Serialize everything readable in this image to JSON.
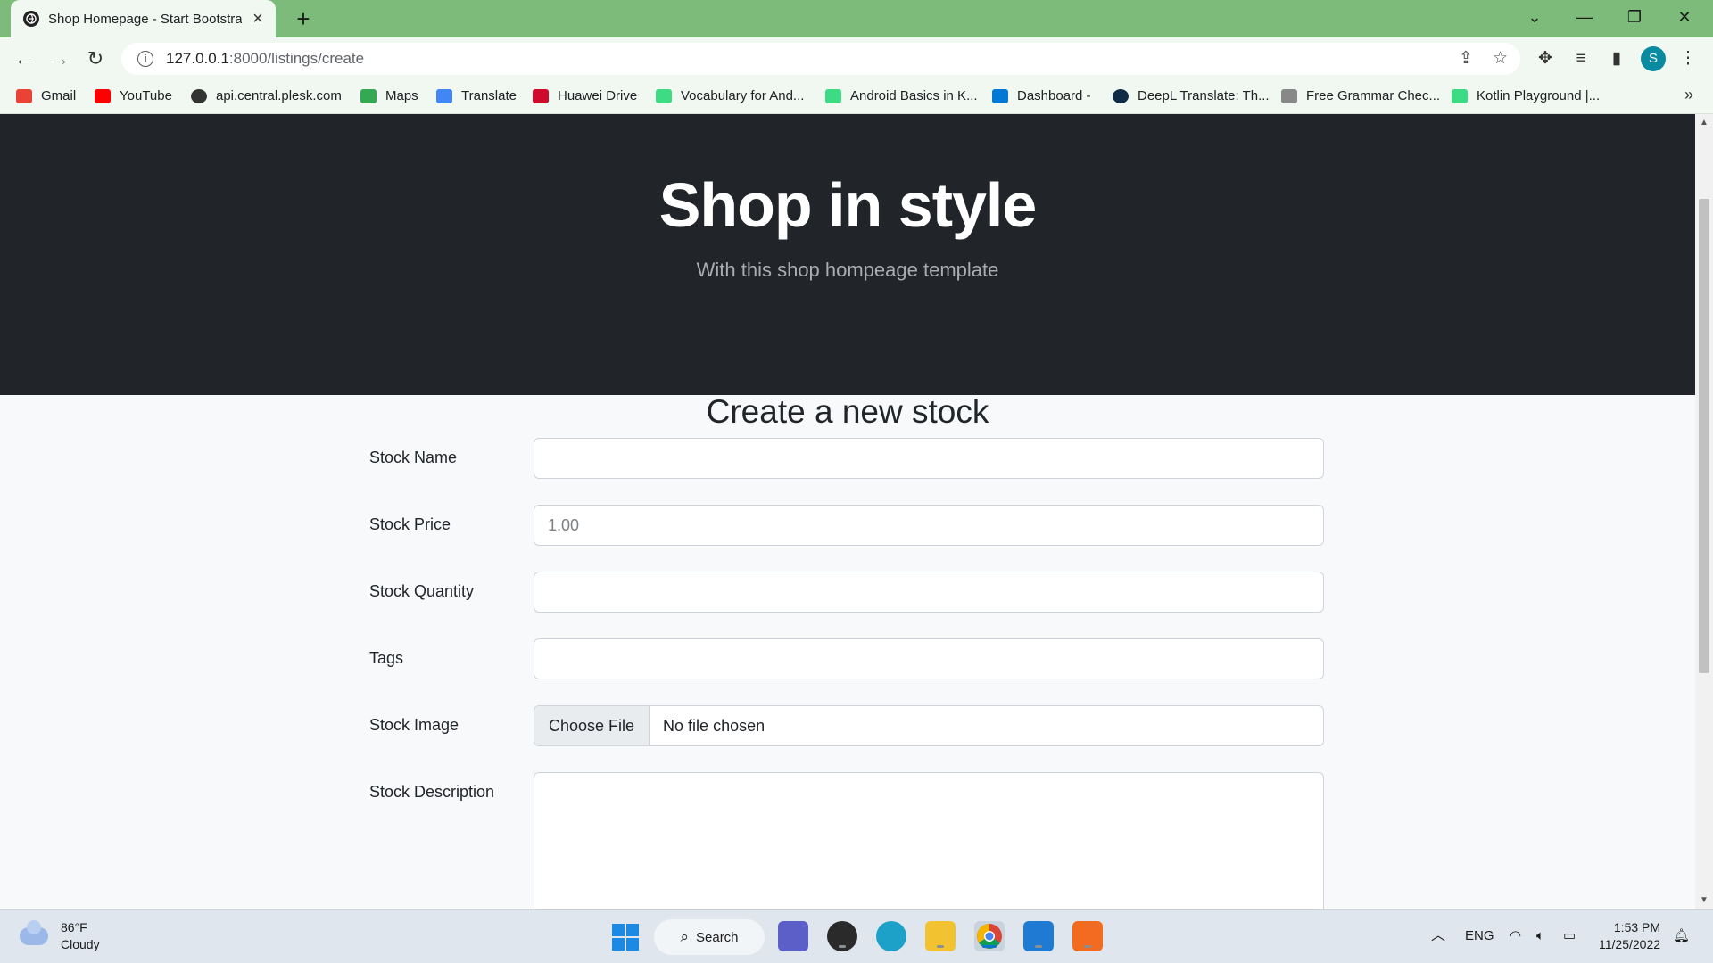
{
  "browser": {
    "tab_title": "Shop Homepage - Start Bootstrap",
    "url_host": "127.0.0.1",
    "url_path": ":8000/listings/create",
    "profile_initial": "S",
    "bookmarks": [
      {
        "label": "Gmail",
        "icon": "gmail-icon"
      },
      {
        "label": "YouTube",
        "icon": "youtube-icon"
      },
      {
        "label": "api.central.plesk.com",
        "icon": "globe-icon"
      },
      {
        "label": "Maps",
        "icon": "maps-icon"
      },
      {
        "label": "Translate",
        "icon": "translate-icon"
      },
      {
        "label": "Huawei Drive",
        "icon": "huawei-icon"
      },
      {
        "label": "Vocabulary for And...",
        "icon": "android-icon"
      },
      {
        "label": "Android Basics in K...",
        "icon": "android-icon"
      },
      {
        "label": "Dashboard -",
        "icon": "dashboard-icon"
      },
      {
        "label": "DeepL Translate: Th...",
        "icon": "deepl-icon"
      },
      {
        "label": "Free Grammar Chec...",
        "icon": "pen-icon"
      },
      {
        "label": "Kotlin Playground |...",
        "icon": "android-icon"
      }
    ]
  },
  "hero": {
    "title": "Shop in style",
    "subtitle": "With this shop hompeage template"
  },
  "form": {
    "title": "Create a new stock",
    "fields": {
      "name_label": "Stock Name",
      "name_value": "",
      "price_label": "Stock Price",
      "price_placeholder": "1.00",
      "quantity_label": "Stock Quantity",
      "quantity_value": "",
      "tags_label": "Tags",
      "tags_value": "",
      "image_label": "Stock Image",
      "image_button": "Choose File",
      "image_status": "No file chosen",
      "description_label": "Stock Description"
    }
  },
  "taskbar": {
    "weather_temp": "86°F",
    "weather_desc": "Cloudy",
    "search_label": "Search",
    "language": "ENG",
    "time": "1:53 PM",
    "date": "11/25/2022"
  },
  "colors": {
    "tabbar": "#7cbb7a",
    "hero_bg": "#212529",
    "page_bg": "#f8f9fa"
  }
}
